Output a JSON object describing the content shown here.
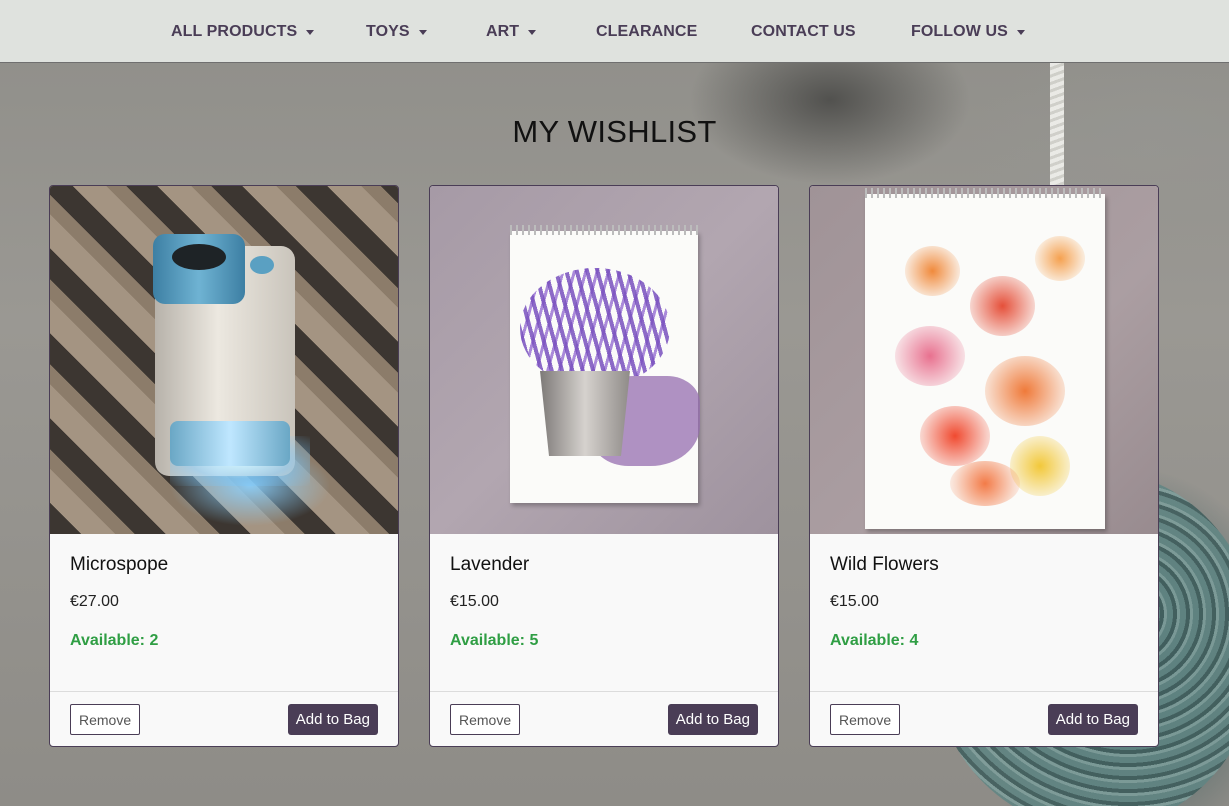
{
  "nav": {
    "items": [
      {
        "label": "ALL PRODUCTS",
        "dropdown": true
      },
      {
        "label": "TOYS",
        "dropdown": true
      },
      {
        "label": "ART",
        "dropdown": true
      },
      {
        "label": "CLEARANCE",
        "dropdown": false
      },
      {
        "label": "CONTACT US",
        "dropdown": false
      },
      {
        "label": "FOLLOW US",
        "dropdown": true
      }
    ]
  },
  "page": {
    "title": "MY WISHLIST"
  },
  "wishlist": [
    {
      "name": "Microspope",
      "price": "€27.00",
      "availability": "Available: 2",
      "image_icon": "microscope-photo"
    },
    {
      "name": "Lavender",
      "price": "€15.00",
      "availability": "Available: 5",
      "image_icon": "lavender-painting-photo"
    },
    {
      "name": "Wild Flowers",
      "price": "€15.00",
      "availability": "Available: 4",
      "image_icon": "wildflowers-painting-photo"
    }
  ],
  "actions": {
    "remove_label": "Remove",
    "add_label": "Add to Bag"
  },
  "colors": {
    "brand": "#4a3d56",
    "navbar_bg": "#dfe2de",
    "available": "#2f9e44"
  }
}
